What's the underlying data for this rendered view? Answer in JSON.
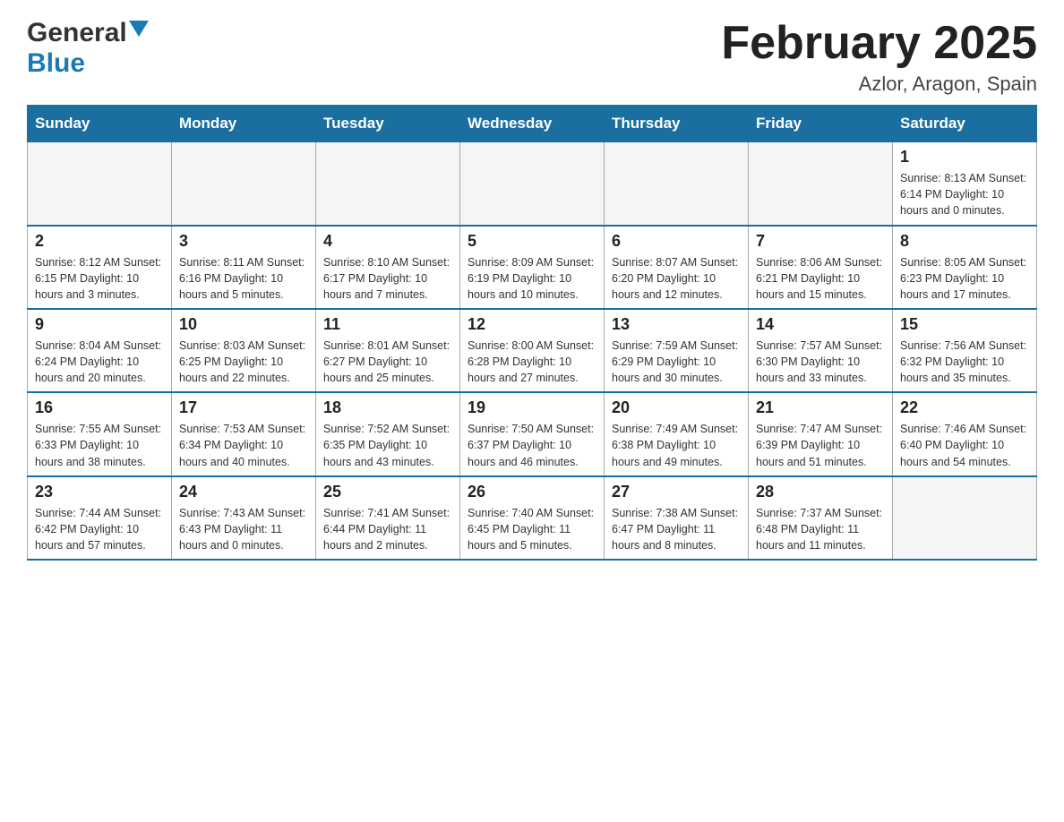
{
  "header": {
    "logo_general": "General",
    "logo_blue": "Blue",
    "title": "February 2025",
    "subtitle": "Azlor, Aragon, Spain"
  },
  "weekdays": [
    "Sunday",
    "Monday",
    "Tuesday",
    "Wednesday",
    "Thursday",
    "Friday",
    "Saturday"
  ],
  "weeks": [
    [
      {
        "day": "",
        "info": ""
      },
      {
        "day": "",
        "info": ""
      },
      {
        "day": "",
        "info": ""
      },
      {
        "day": "",
        "info": ""
      },
      {
        "day": "",
        "info": ""
      },
      {
        "day": "",
        "info": ""
      },
      {
        "day": "1",
        "info": "Sunrise: 8:13 AM\nSunset: 6:14 PM\nDaylight: 10 hours and 0 minutes."
      }
    ],
    [
      {
        "day": "2",
        "info": "Sunrise: 8:12 AM\nSunset: 6:15 PM\nDaylight: 10 hours and 3 minutes."
      },
      {
        "day": "3",
        "info": "Sunrise: 8:11 AM\nSunset: 6:16 PM\nDaylight: 10 hours and 5 minutes."
      },
      {
        "day": "4",
        "info": "Sunrise: 8:10 AM\nSunset: 6:17 PM\nDaylight: 10 hours and 7 minutes."
      },
      {
        "day": "5",
        "info": "Sunrise: 8:09 AM\nSunset: 6:19 PM\nDaylight: 10 hours and 10 minutes."
      },
      {
        "day": "6",
        "info": "Sunrise: 8:07 AM\nSunset: 6:20 PM\nDaylight: 10 hours and 12 minutes."
      },
      {
        "day": "7",
        "info": "Sunrise: 8:06 AM\nSunset: 6:21 PM\nDaylight: 10 hours and 15 minutes."
      },
      {
        "day": "8",
        "info": "Sunrise: 8:05 AM\nSunset: 6:23 PM\nDaylight: 10 hours and 17 minutes."
      }
    ],
    [
      {
        "day": "9",
        "info": "Sunrise: 8:04 AM\nSunset: 6:24 PM\nDaylight: 10 hours and 20 minutes."
      },
      {
        "day": "10",
        "info": "Sunrise: 8:03 AM\nSunset: 6:25 PM\nDaylight: 10 hours and 22 minutes."
      },
      {
        "day": "11",
        "info": "Sunrise: 8:01 AM\nSunset: 6:27 PM\nDaylight: 10 hours and 25 minutes."
      },
      {
        "day": "12",
        "info": "Sunrise: 8:00 AM\nSunset: 6:28 PM\nDaylight: 10 hours and 27 minutes."
      },
      {
        "day": "13",
        "info": "Sunrise: 7:59 AM\nSunset: 6:29 PM\nDaylight: 10 hours and 30 minutes."
      },
      {
        "day": "14",
        "info": "Sunrise: 7:57 AM\nSunset: 6:30 PM\nDaylight: 10 hours and 33 minutes."
      },
      {
        "day": "15",
        "info": "Sunrise: 7:56 AM\nSunset: 6:32 PM\nDaylight: 10 hours and 35 minutes."
      }
    ],
    [
      {
        "day": "16",
        "info": "Sunrise: 7:55 AM\nSunset: 6:33 PM\nDaylight: 10 hours and 38 minutes."
      },
      {
        "day": "17",
        "info": "Sunrise: 7:53 AM\nSunset: 6:34 PM\nDaylight: 10 hours and 40 minutes."
      },
      {
        "day": "18",
        "info": "Sunrise: 7:52 AM\nSunset: 6:35 PM\nDaylight: 10 hours and 43 minutes."
      },
      {
        "day": "19",
        "info": "Sunrise: 7:50 AM\nSunset: 6:37 PM\nDaylight: 10 hours and 46 minutes."
      },
      {
        "day": "20",
        "info": "Sunrise: 7:49 AM\nSunset: 6:38 PM\nDaylight: 10 hours and 49 minutes."
      },
      {
        "day": "21",
        "info": "Sunrise: 7:47 AM\nSunset: 6:39 PM\nDaylight: 10 hours and 51 minutes."
      },
      {
        "day": "22",
        "info": "Sunrise: 7:46 AM\nSunset: 6:40 PM\nDaylight: 10 hours and 54 minutes."
      }
    ],
    [
      {
        "day": "23",
        "info": "Sunrise: 7:44 AM\nSunset: 6:42 PM\nDaylight: 10 hours and 57 minutes."
      },
      {
        "day": "24",
        "info": "Sunrise: 7:43 AM\nSunset: 6:43 PM\nDaylight: 11 hours and 0 minutes."
      },
      {
        "day": "25",
        "info": "Sunrise: 7:41 AM\nSunset: 6:44 PM\nDaylight: 11 hours and 2 minutes."
      },
      {
        "day": "26",
        "info": "Sunrise: 7:40 AM\nSunset: 6:45 PM\nDaylight: 11 hours and 5 minutes."
      },
      {
        "day": "27",
        "info": "Sunrise: 7:38 AM\nSunset: 6:47 PM\nDaylight: 11 hours and 8 minutes."
      },
      {
        "day": "28",
        "info": "Sunrise: 7:37 AM\nSunset: 6:48 PM\nDaylight: 11 hours and 11 minutes."
      },
      {
        "day": "",
        "info": ""
      }
    ]
  ]
}
